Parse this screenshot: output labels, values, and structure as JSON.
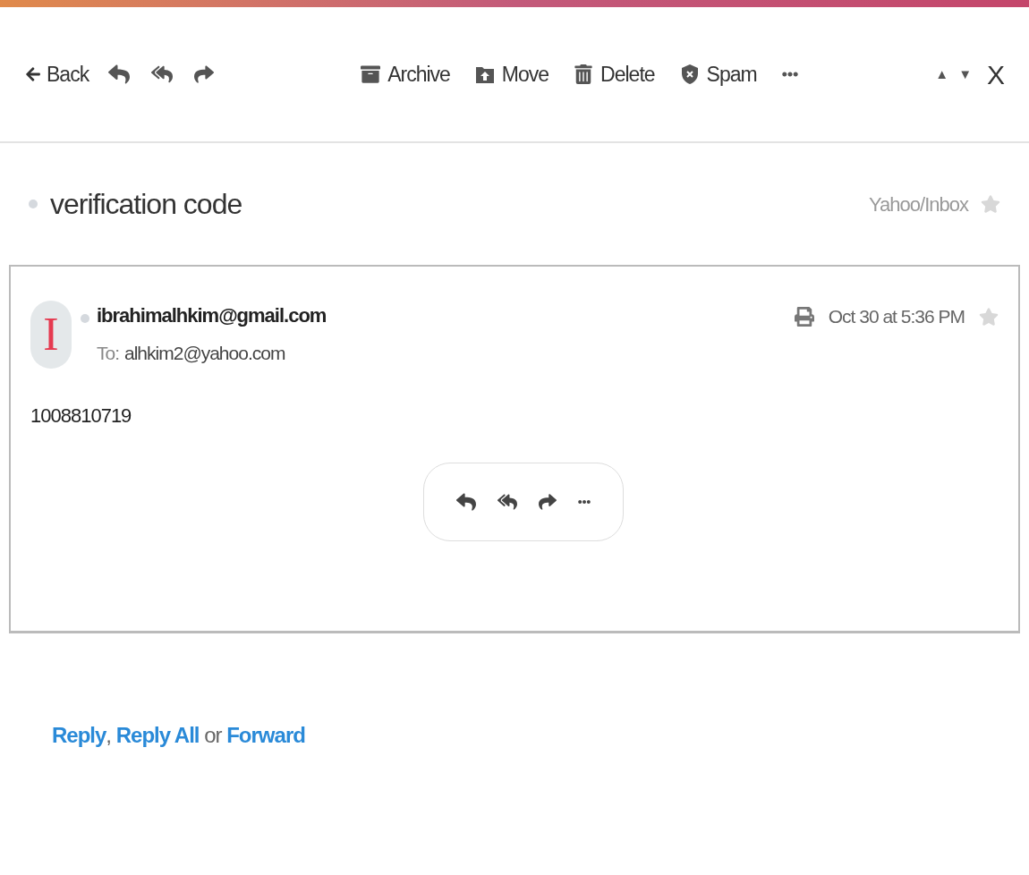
{
  "toolbar": {
    "back": {
      "label": "Back"
    },
    "actions": [
      {
        "kind": "archive",
        "label": "Archive"
      },
      {
        "kind": "move",
        "label": "Move"
      },
      {
        "kind": "delete",
        "label": "Delete"
      },
      {
        "kind": "spam",
        "label": "Spam"
      }
    ],
    "prev": "▲",
    "next": "▼",
    "close": "X"
  },
  "subject": {
    "title": "verification code",
    "unread": true,
    "folder": "Yahoo/Inbox",
    "starred": false
  },
  "message": {
    "avatar_letter": "I",
    "sender": "ibrahimalhkim@gmail.com",
    "unread": true,
    "to_label": "To:",
    "to": "alhkim2@yahoo.com",
    "date": "Oct 30 at 5:36 PM",
    "starred": false,
    "body": "1008810719"
  },
  "footer": [
    {
      "kind": "link",
      "text": "Reply"
    },
    {
      "kind": "text",
      "text": ", "
    },
    {
      "kind": "link",
      "text": "Reply All"
    },
    {
      "kind": "text",
      "text": " or "
    },
    {
      "kind": "link",
      "text": "Forward"
    }
  ]
}
